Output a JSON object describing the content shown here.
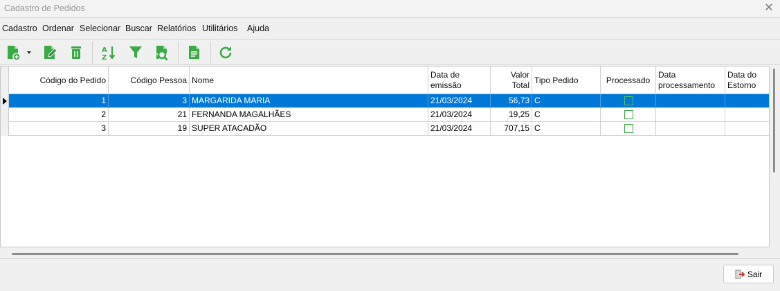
{
  "window": {
    "title": "Cadastro de Pedidos",
    "close_glyph": "✕"
  },
  "menu": [
    {
      "label": "Cadastro"
    },
    {
      "label": "Ordenar"
    },
    {
      "label": "Selecionar"
    },
    {
      "label": "Buscar"
    },
    {
      "label": "Relatórios"
    },
    {
      "label": "Utilitários"
    },
    {
      "label": "Ajuda"
    }
  ],
  "toolbar": {
    "accent": "#3aaa45",
    "buttons": [
      "new-document-icon",
      "dropdown-arrow-icon",
      "edit-icon",
      "delete-icon",
      "sort-az-icon",
      "filter-icon",
      "search-document-icon",
      "report-icon",
      "refresh-icon"
    ]
  },
  "table": {
    "columns": [
      {
        "label": "Código do Pedido"
      },
      {
        "label": "Código Pessoa"
      },
      {
        "label": "Nome"
      },
      {
        "label": "Data de emissão"
      },
      {
        "label": "Valor Total"
      },
      {
        "label": "Tipo Pedido"
      },
      {
        "label": "Processado"
      },
      {
        "label": "Data processamento"
      },
      {
        "label": "Data do Estorno"
      }
    ],
    "rows": [
      {
        "codigo_pedido": "1",
        "codigo_pessoa": "3",
        "nome": "MARGARIDA MARIA",
        "data_emissao": "21/03/2024",
        "valor_total": "56,73",
        "tipo_pedido": "C",
        "processado": false,
        "data_processamento": "",
        "data_estorno": ""
      },
      {
        "codigo_pedido": "2",
        "codigo_pessoa": "21",
        "nome": "FERNANDA MAGALHÃES",
        "data_emissao": "21/03/2024",
        "valor_total": "19,25",
        "tipo_pedido": "C",
        "processado": false,
        "data_processamento": "",
        "data_estorno": ""
      },
      {
        "codigo_pedido": "3",
        "codigo_pessoa": "19",
        "nome": "SUPER ATACADÃO",
        "data_emissao": "21/03/2024",
        "valor_total": "707,15",
        "tipo_pedido": "C",
        "processado": false,
        "data_processamento": "",
        "data_estorno": ""
      }
    ],
    "selected_row": 0,
    "selection_color": "#0078d7"
  },
  "footer": {
    "exit_label": "Sair"
  }
}
